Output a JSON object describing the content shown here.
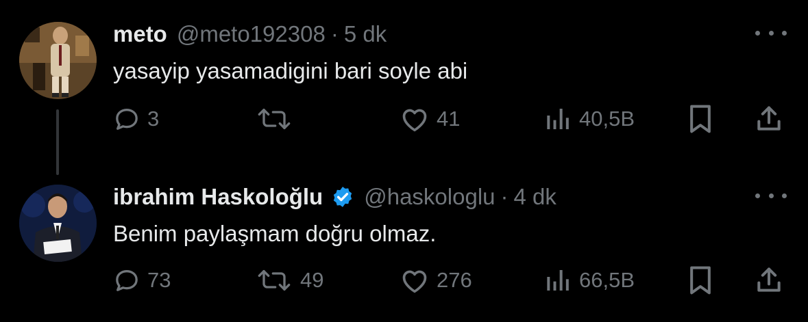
{
  "tweets": [
    {
      "display_name": "meto",
      "handle": "@meto192308",
      "separator": "·",
      "time": "5 dk",
      "text": "yasayip yasamadigini bari soyle abi",
      "verified": false,
      "actions": {
        "reply_count": "3",
        "retweet_count": "",
        "like_count": "41",
        "views_count": "40,5B"
      }
    },
    {
      "display_name": "ibrahim Haskoloğlu",
      "handle": "@haskologlu",
      "separator": "·",
      "time": "4 dk",
      "text": "Benim paylaşmam doğru olmaz.",
      "verified": true,
      "actions": {
        "reply_count": "73",
        "retweet_count": "49",
        "like_count": "276",
        "views_count": "66,5B"
      }
    }
  ],
  "icons": {
    "reply": "speech-bubble-icon",
    "retweet": "retweet-icon",
    "like": "heart-icon",
    "views": "bar-chart-icon",
    "bookmark": "bookmark-icon",
    "share": "share-upload-icon",
    "more": "more-dots-icon",
    "verified": "verified-badge-icon"
  },
  "colors": {
    "background": "#000000",
    "text_primary": "#e7e9ea",
    "text_secondary": "#71767b",
    "verified_blue": "#1d9bf0",
    "thread_line": "#333639"
  }
}
